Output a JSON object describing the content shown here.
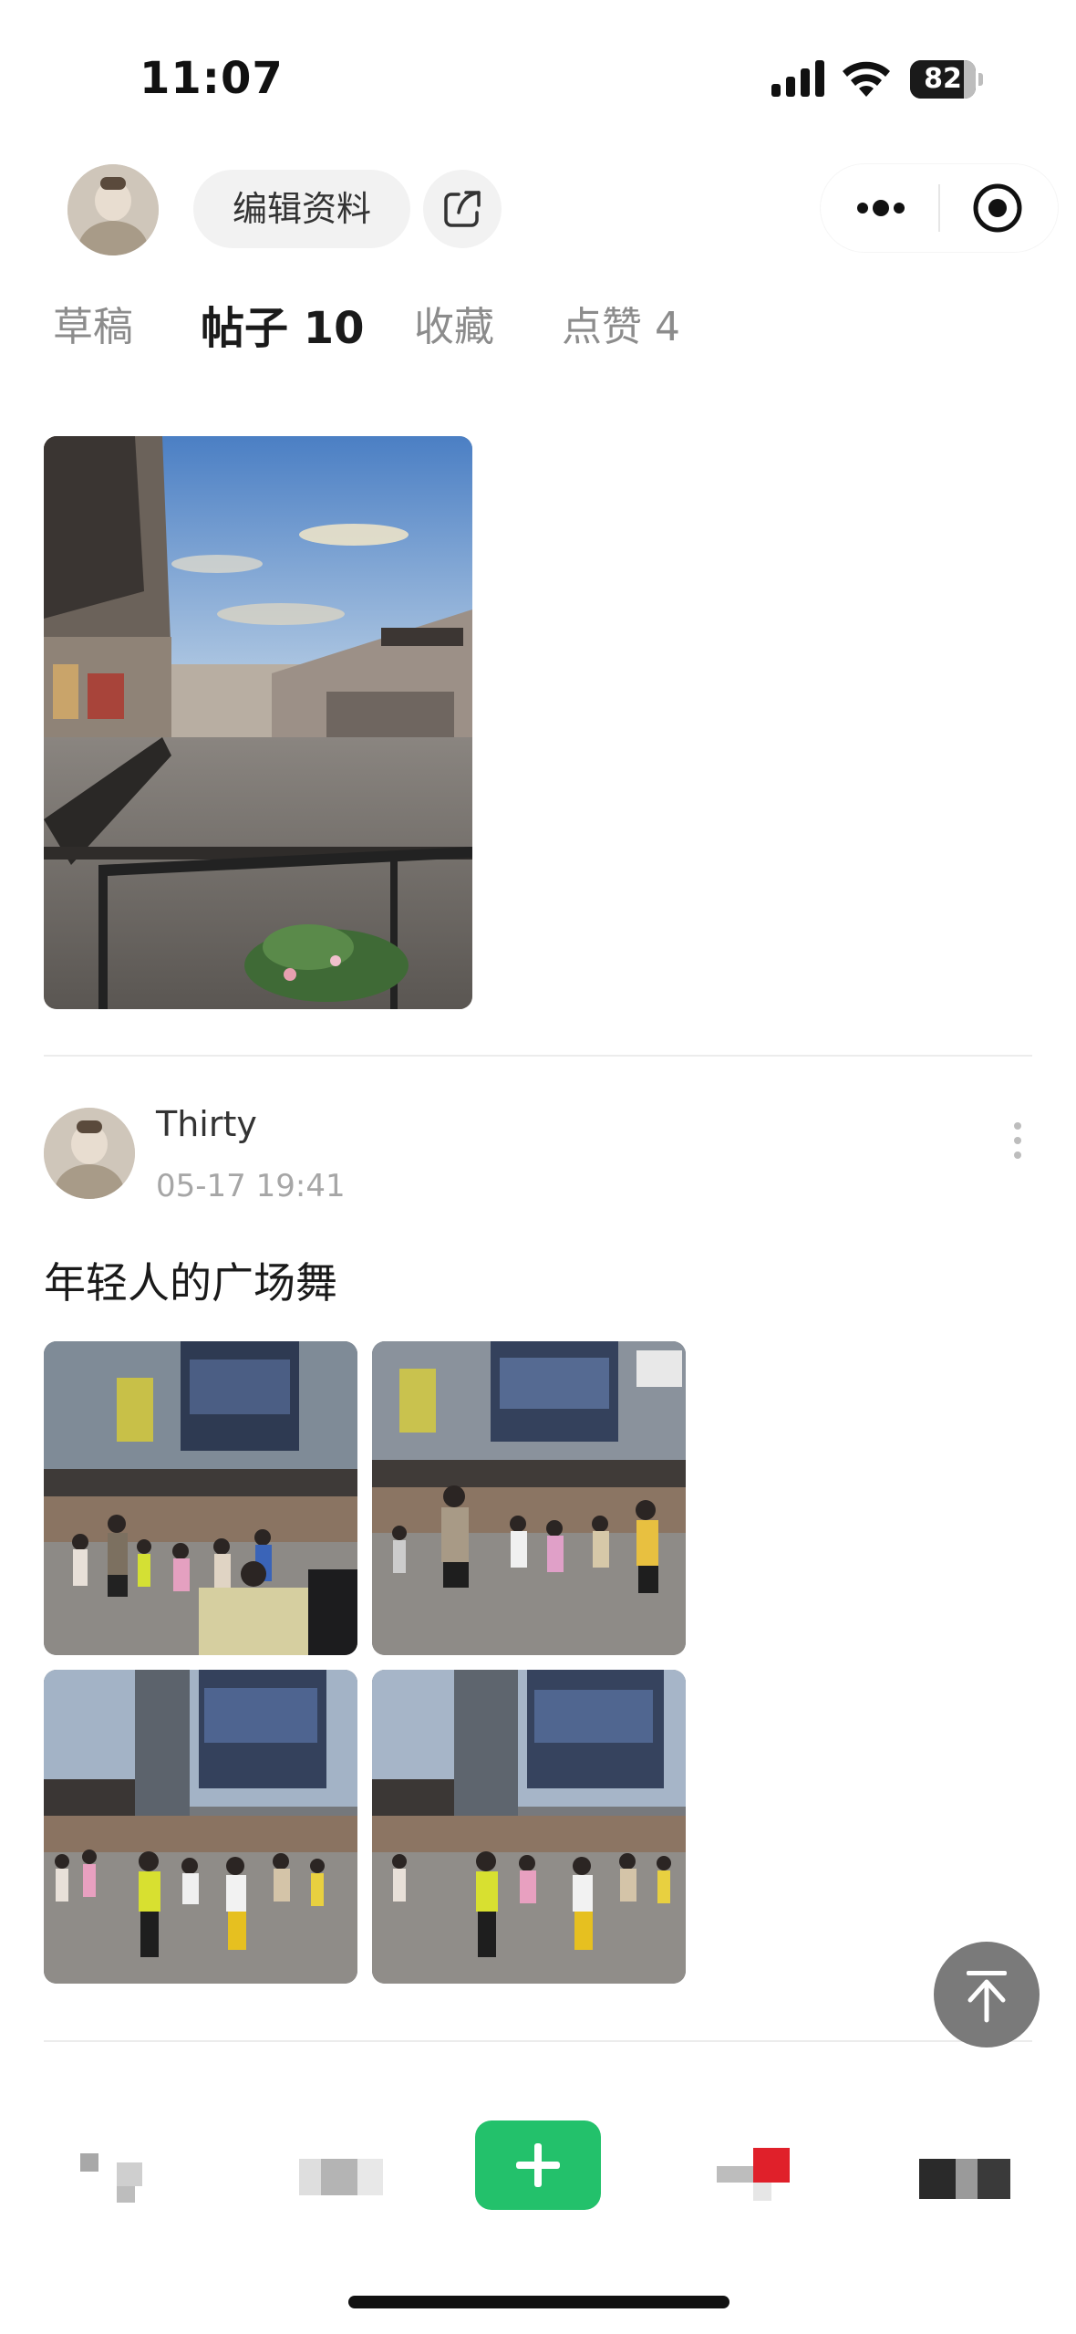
{
  "status_bar": {
    "time": "11:07",
    "battery": "82",
    "battery_level": 0.82
  },
  "header": {
    "edit_profile_label": "编辑资料"
  },
  "tabs": [
    {
      "label": "草稿",
      "active": false
    },
    {
      "label": "帖子 10",
      "active": true
    },
    {
      "label": "收藏",
      "active": false
    },
    {
      "label": "点赞 4",
      "active": false
    }
  ],
  "post": {
    "author": "Thirty",
    "time": "05-17 19:41",
    "text": "年轻人的广场舞"
  },
  "colors": {
    "accent_green": "#23c16b",
    "notify_red": "#e0202a"
  },
  "icons": [
    "share-icon",
    "more-icon",
    "close-target-icon",
    "kebab-icon",
    "back-to-top-icon",
    "plus-icon"
  ]
}
